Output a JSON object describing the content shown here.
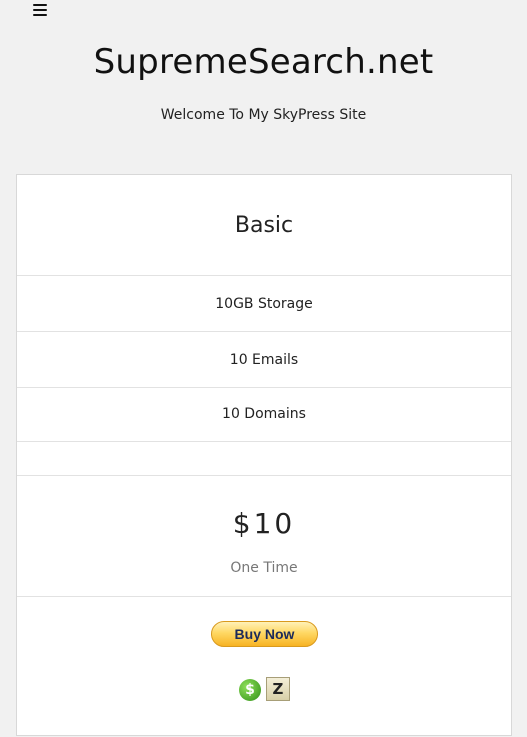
{
  "header": {
    "menu_icon": "hamburger-menu-icon",
    "site_title": "SupremeSearch.net",
    "tagline": "Welcome To My SkyPress Site"
  },
  "pricing": {
    "plan_name": "Basic",
    "features": [
      "10GB Storage",
      "10 Emails",
      "10 Domains"
    ],
    "price": "$10",
    "term": "One Time",
    "buy_label": "Buy Now",
    "payment_icons": [
      "dollar-coin-icon",
      "z-letter-icon"
    ]
  }
}
